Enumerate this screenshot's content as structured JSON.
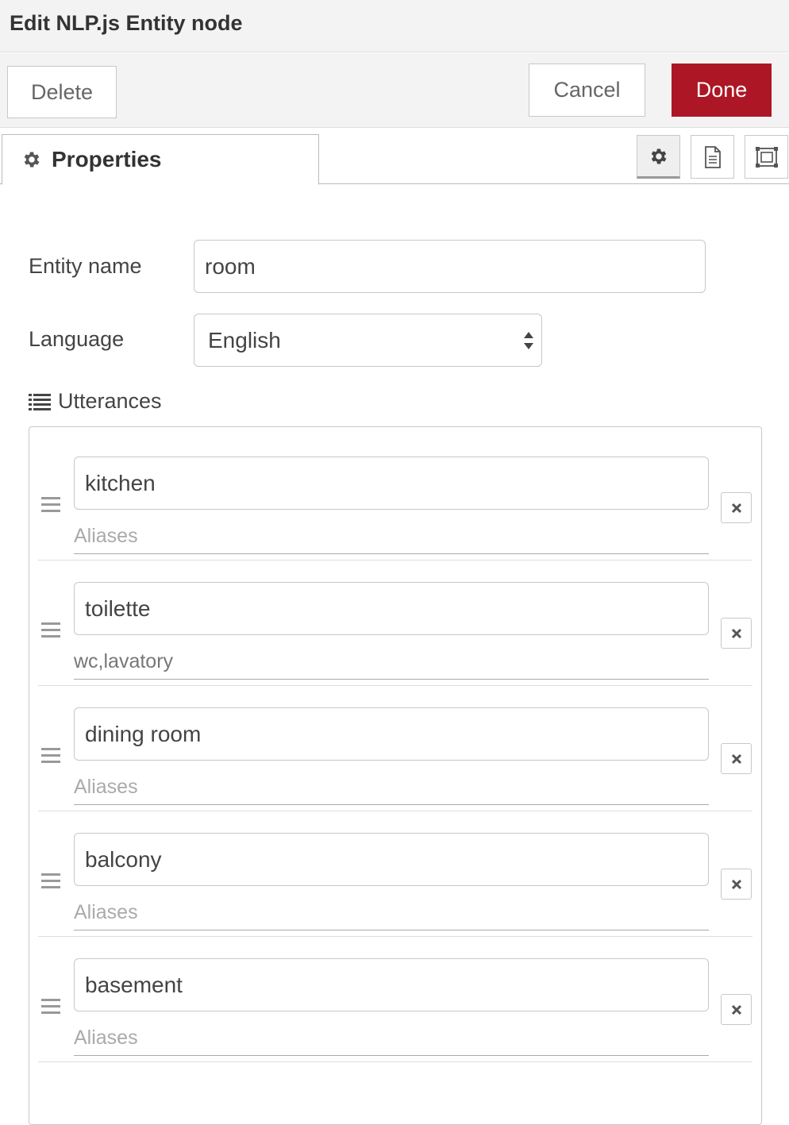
{
  "dialog": {
    "title": "Edit NLP.js Entity node"
  },
  "buttons": {
    "delete": "Delete",
    "cancel": "Cancel",
    "done": "Done"
  },
  "colors": {
    "done_button": "#ad1625",
    "header_bg": "#f3f3f3"
  },
  "tabs": {
    "properties_label": "Properties",
    "properties_icon": "gear-icon",
    "toolbar_icons": [
      "gear-icon",
      "document-icon",
      "frame-icon"
    ]
  },
  "form": {
    "entity_name_label": "Entity name",
    "entity_name_value": "room",
    "language_label": "Language",
    "language_value": "English",
    "utterances_label": "Utterances"
  },
  "utterances": [
    {
      "value": "kitchen",
      "aliases": "",
      "aliases_placeholder": "Aliases"
    },
    {
      "value": "toilette",
      "aliases": "wc,lavatory",
      "aliases_placeholder": "Aliases"
    },
    {
      "value": "dining room",
      "aliases": "",
      "aliases_placeholder": "Aliases"
    },
    {
      "value": "balcony",
      "aliases": "",
      "aliases_placeholder": "Aliases"
    },
    {
      "value": "basement",
      "aliases": "",
      "aliases_placeholder": "Aliases"
    }
  ]
}
